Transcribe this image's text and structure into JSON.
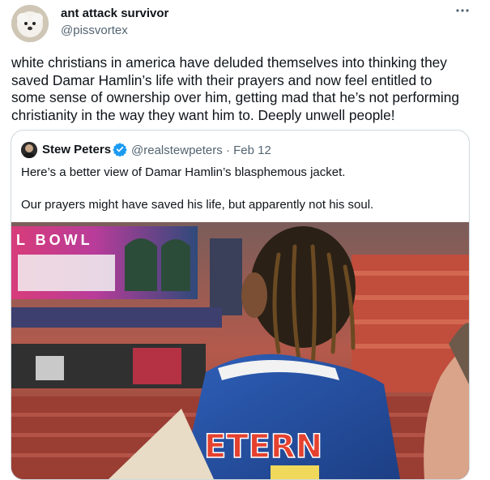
{
  "tweet": {
    "author_name": "ant attack survivor",
    "author_handle": "@pissvortex",
    "more_icon": "more-icon",
    "text_lines": [
      "white christians in america have deluded themselves into thinking they",
      "saved Damar Hamlin’s life with their prayers and now feel entitled to",
      "some sense of ownership over him, getting mad that he’s not performing",
      "christianity in the way they want him to. Deeply unwell people!"
    ]
  },
  "quoted_tweet": {
    "author_name": "Stew Peters",
    "verified_icon": "verified-badge-icon",
    "handle_and_date": "@realstewpeters · Feb 12",
    "paragraphs": [
      "Here’s a better view of Damar Hamlin’s blasphemous jacket.",
      "Our prayers might have saved his life, but apparently not his soul."
    ],
    "media": {
      "description_icon": "stadium-photo",
      "banner_text": "L BOWL",
      "jacket_text": "ETERN"
    }
  },
  "colors": {
    "text": "#0f1419",
    "secondary": "#536471",
    "border": "#cfd9de",
    "verified": "#1d9bf0"
  }
}
